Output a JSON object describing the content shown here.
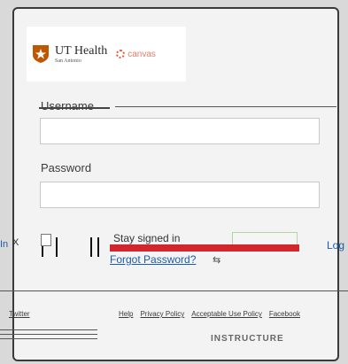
{
  "logo": {
    "ut_name": "UT Health",
    "ut_sub": "San Antonio",
    "canvas_word": "canvas",
    "brand_color": "#bf5700",
    "canvas_color": "#e35a3b"
  },
  "form": {
    "username_label": "Username",
    "username_value": "",
    "password_label": "Password",
    "password_value": "",
    "stay_signed_in": "Stay signed in",
    "login_label": "Log",
    "login_left": "In",
    "x_mark": "X",
    "forgot_password": "Forgot Password?"
  },
  "footer": {
    "twitter": "Twitter",
    "links": [
      "Help",
      "Privacy Policy",
      "Acceptable Use Policy",
      "Facebook"
    ],
    "brand": "INSTRUCTURE"
  }
}
